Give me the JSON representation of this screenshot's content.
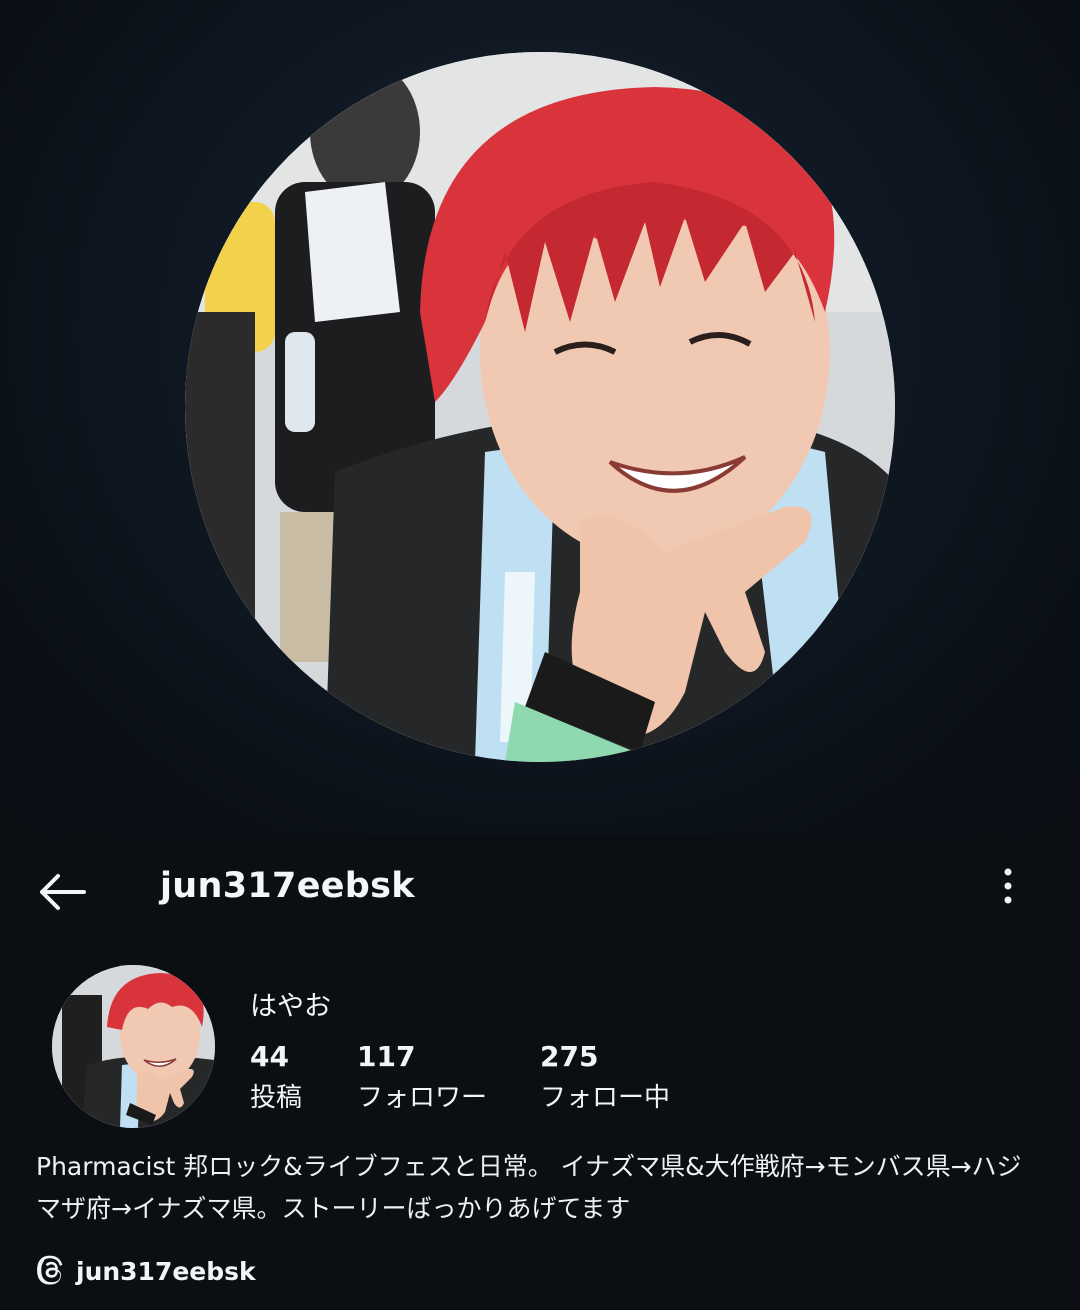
{
  "header": {
    "username": "jun317eebsk"
  },
  "profile": {
    "display_name": "はやお",
    "stats": [
      {
        "count": "44",
        "label": "投稿"
      },
      {
        "count": "117",
        "label": "フォロワー"
      },
      {
        "count": "275",
        "label": "フォロー中"
      }
    ],
    "bio": "Pharmacist 邦ロック&ライブフェスと日常。 イナズマ県&大作戦府→モンバス県→ハジマザ府→イナズマ県。ストーリーばっかりあげてます",
    "threads_handle": "jun317eebsk"
  },
  "icons": {
    "back": "back-arrow-icon",
    "more": "more-vertical-icon",
    "threads": "threads-icon"
  },
  "colors": {
    "background": "#0b0f14",
    "hair_accent": "#d9343c",
    "text": "#f2f4f6"
  }
}
